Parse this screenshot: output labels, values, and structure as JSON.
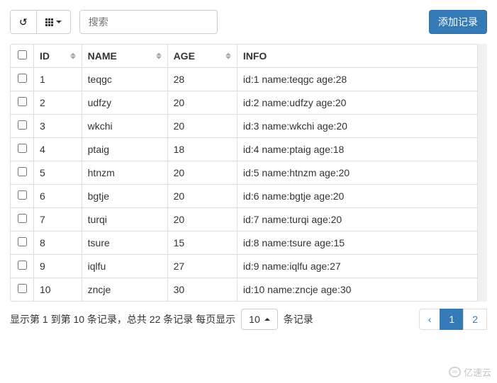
{
  "toolbar": {
    "search_placeholder": "搜索",
    "add_record": "添加记录"
  },
  "columns": [
    "ID",
    "NAME",
    "AGE",
    "INFO"
  ],
  "rows": [
    {
      "id": "1",
      "name": "teqgc",
      "age": "28",
      "info": "id:1 name:teqgc age:28"
    },
    {
      "id": "2",
      "name": "udfzy",
      "age": "20",
      "info": "id:2 name:udfzy age:20"
    },
    {
      "id": "3",
      "name": "wkchi",
      "age": "20",
      "info": "id:3 name:wkchi age:20"
    },
    {
      "id": "4",
      "name": "ptaig",
      "age": "18",
      "info": "id:4 name:ptaig age:18"
    },
    {
      "id": "5",
      "name": "htnzm",
      "age": "20",
      "info": "id:5 name:htnzm age:20"
    },
    {
      "id": "6",
      "name": "bgtje",
      "age": "20",
      "info": "id:6 name:bgtje age:20"
    },
    {
      "id": "7",
      "name": "turqi",
      "age": "20",
      "info": "id:7 name:turqi age:20"
    },
    {
      "id": "8",
      "name": "tsure",
      "age": "15",
      "info": "id:8 name:tsure age:15"
    },
    {
      "id": "9",
      "name": "iqlfu",
      "age": "27",
      "info": "id:9 name:iqlfu age:27"
    },
    {
      "id": "10",
      "name": "zncje",
      "age": "30",
      "info": "id:10 name:zncje age:30"
    }
  ],
  "footer": {
    "info_prefix": "显示第 1 到第 10 条记录，总共 22 条记录 每页显示",
    "page_size": "10",
    "info_suffix": "条记录",
    "pages": [
      "‹",
      "1",
      "2"
    ],
    "active_page": "1"
  },
  "watermark": "亿速云"
}
